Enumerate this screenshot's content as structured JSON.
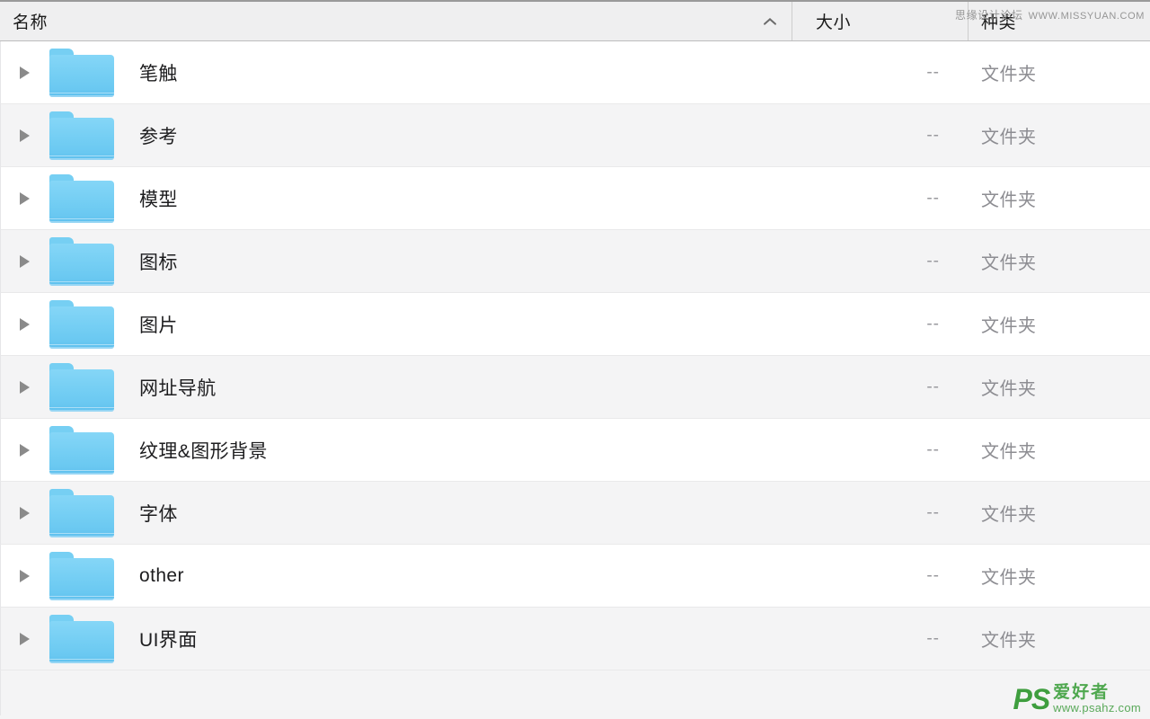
{
  "header": {
    "columns": [
      {
        "label": "名称",
        "key": "name",
        "sorted": true,
        "sort_icon": "chevron-up-icon"
      },
      {
        "label": "大小",
        "key": "size",
        "sorted": false
      },
      {
        "label": "种类",
        "key": "kind",
        "sorted": false
      }
    ]
  },
  "watermark_top": {
    "text_cn": "思缘设计论坛",
    "text_url": "WWW.MISSYUAN.COM"
  },
  "watermark_logo": {
    "mark": "PS",
    "text_cn": "爱好者",
    "url": "www.psahz.com",
    "color": "#3f9e3f"
  },
  "colors": {
    "folder_icon": "#72cdf3",
    "row_alt": "#f4f4f5",
    "row_base": "#ffffff",
    "header_bg": "#efeff0",
    "kind_text": "#8d8d92",
    "size_text": "#9a9a9e"
  },
  "rows": [
    {
      "name": "笔触",
      "size": "--",
      "kind": "文件夹",
      "icon": "folder-icon",
      "disclosure": "triangle-right-icon"
    },
    {
      "name": "参考",
      "size": "--",
      "kind": "文件夹",
      "icon": "folder-icon",
      "disclosure": "triangle-right-icon"
    },
    {
      "name": "模型",
      "size": "--",
      "kind": "文件夹",
      "icon": "folder-icon",
      "disclosure": "triangle-right-icon"
    },
    {
      "name": "图标",
      "size": "--",
      "kind": "文件夹",
      "icon": "folder-icon",
      "disclosure": "triangle-right-icon"
    },
    {
      "name": "图片",
      "size": "--",
      "kind": "文件夹",
      "icon": "folder-icon",
      "disclosure": "triangle-right-icon"
    },
    {
      "name": "网址导航",
      "size": "--",
      "kind": "文件夹",
      "icon": "folder-icon",
      "disclosure": "triangle-right-icon"
    },
    {
      "name": "纹理&图形背景",
      "size": "--",
      "kind": "文件夹",
      "icon": "folder-icon",
      "disclosure": "triangle-right-icon"
    },
    {
      "name": "字体",
      "size": "--",
      "kind": "文件夹",
      "icon": "folder-icon",
      "disclosure": "triangle-right-icon"
    },
    {
      "name": "other",
      "size": "--",
      "kind": "文件夹",
      "icon": "folder-icon",
      "disclosure": "triangle-right-icon"
    },
    {
      "name": "UI界面",
      "size": "--",
      "kind": "文件夹",
      "icon": "folder-icon",
      "disclosure": "triangle-right-icon"
    }
  ]
}
